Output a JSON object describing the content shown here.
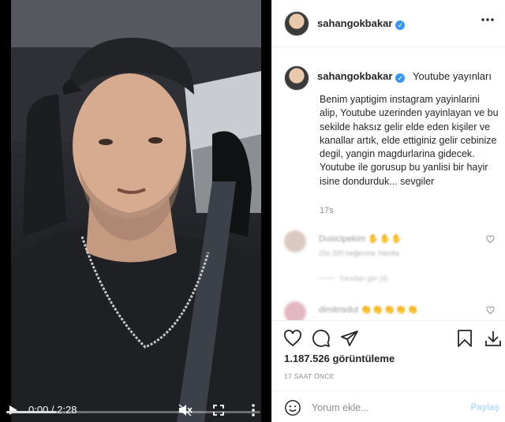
{
  "post": {
    "username": "sahangokbakar",
    "location": "Youtube yayınları",
    "caption": "Benim yaptigim instagram yayinlarini alip, Youtube uzerinden yayinlayan ve bu sekilde haksız gelir elde eden kişiler ve kanallar artık, elde ettiginiz gelir cebinize degil, yangin magdurlarina gidecek. Youtube ile gorusup bu yanlisi bir hayir isine dondurduk... sevgiler",
    "caption_age": "17s",
    "views": "1.187.526 görüntüleme",
    "time_ago": "17 SAAT ÖNCE"
  },
  "video": {
    "current_time": "0:00",
    "duration": "2:28",
    "time_display": "0:00 / 2:28",
    "progress": 0.2
  },
  "comments": [
    {
      "username": "Dusicipekim",
      "emoji": "✋✋✋",
      "meta": "15s  200 beğenme  Yanıtla",
      "replies": "Yanıtları gör (3)"
    },
    {
      "username": "dimitrisdut",
      "emoji": "👏👏👏👏👏",
      "meta": "",
      "replies": ""
    }
  ],
  "add_comment": {
    "placeholder": "Yorum ekle...",
    "post_label": "Paylaş"
  },
  "icons": {
    "verified": "verified-badge-icon",
    "like": "heart-icon",
    "comment": "comment-icon",
    "share": "paper-plane-icon",
    "save": "bookmark-icon",
    "download": "download-icon",
    "emoji": "smiley-icon"
  },
  "colors": {
    "verified": "#3897f0",
    "post_button": "#b2dffc",
    "text": "#262626",
    "secondary": "#8e8e8e"
  }
}
